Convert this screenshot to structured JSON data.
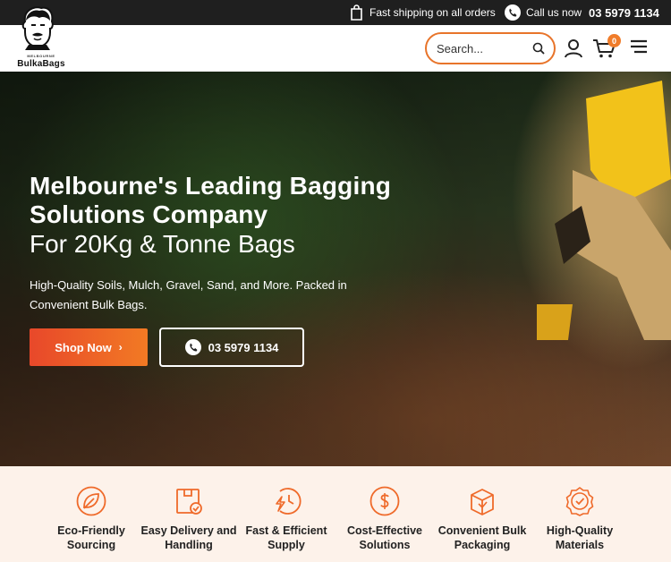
{
  "topbar": {
    "shipping_text": "Fast shipping on all orders",
    "call_label": "Call us now",
    "phone": "03 5979 1134"
  },
  "header": {
    "logo_small": "MELBOURNE",
    "logo_text": "BulkaBags",
    "search_placeholder": "Search...",
    "cart_count": "0"
  },
  "hero": {
    "title": "Melbourne's Leading Bagging Solutions Company",
    "subtitle": "For 20Kg & Tonne Bags",
    "description": "High-Quality Soils, Mulch, Gravel, Sand, and More. Packed in Convenient Bulk Bags.",
    "shop_button": "Shop Now",
    "call_button": "03 5979 1134"
  },
  "features": [
    {
      "label": "Eco-Friendly Sourcing",
      "icon": "leaf-icon"
    },
    {
      "label": "Easy Delivery and Handling",
      "icon": "box-check-icon"
    },
    {
      "label": "Fast & Efficient Supply",
      "icon": "clock-speed-icon"
    },
    {
      "label": "Cost-Effective Solutions",
      "icon": "dollar-coin-icon"
    },
    {
      "label": "Convenient Bulk Packaging",
      "icon": "package-icon"
    },
    {
      "label": "High-Quality Materials",
      "icon": "quality-badge-icon"
    }
  ],
  "colors": {
    "accent": "#f07c2a",
    "topbar_bg": "#1f1f1f",
    "features_bg": "#fdf2ea"
  }
}
